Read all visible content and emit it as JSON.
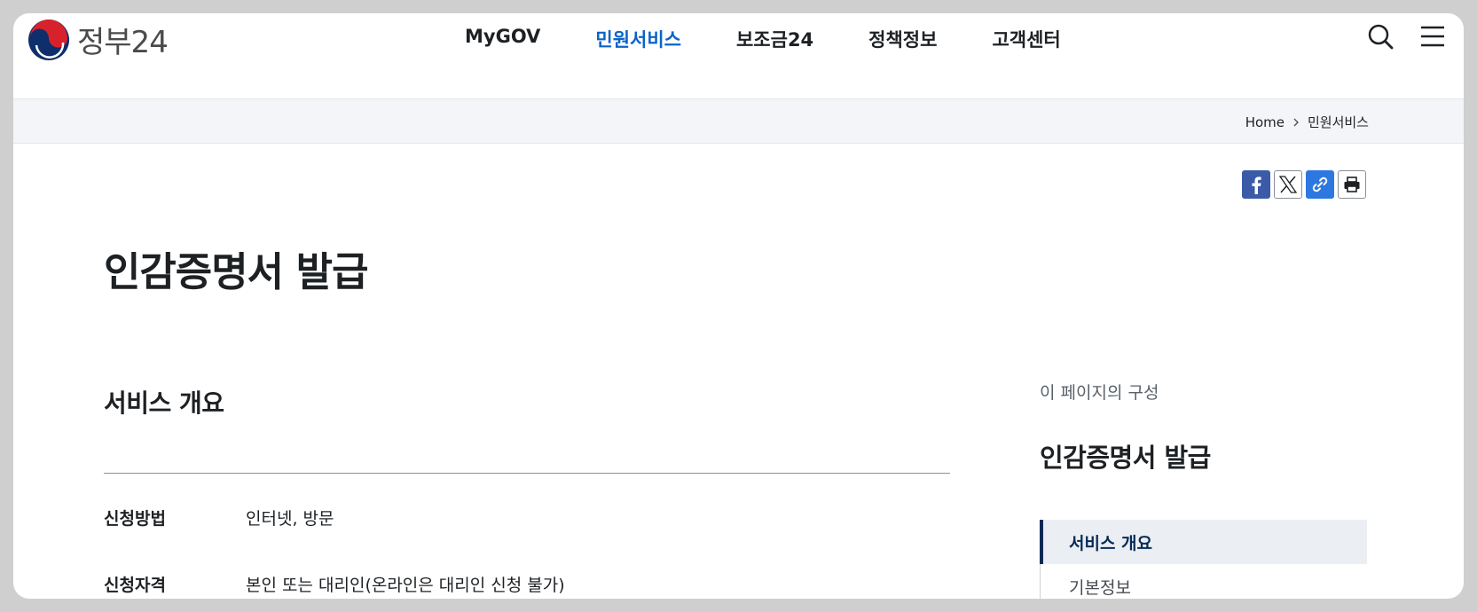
{
  "header": {
    "logo_text": "정부24",
    "nav": [
      {
        "label": "MyGOV",
        "active": false
      },
      {
        "label": "민원서비스",
        "active": true
      },
      {
        "label": "보조금24",
        "active": false
      },
      {
        "label": "정책정보",
        "active": false
      },
      {
        "label": "고객센터",
        "active": false
      }
    ],
    "icons": [
      "search-icon",
      "menu-icon"
    ]
  },
  "breadcrumb": {
    "items": [
      "Home",
      "민원서비스"
    ]
  },
  "share": {
    "buttons": [
      "facebook-icon",
      "x-icon",
      "link-icon",
      "print-icon"
    ]
  },
  "page": {
    "title": "인감증명서 발급"
  },
  "section": {
    "title": "서비스 개요",
    "rows": [
      {
        "label": "신청방법",
        "value": "인터넷, 방문"
      },
      {
        "label": "신청자격",
        "value": "본인 또는 대리인(온라인은 대리인 신청 불가)"
      }
    ]
  },
  "toc": {
    "caption": "이 페이지의 구성",
    "title": "인감증명서 발급",
    "items": [
      {
        "label": "서비스 개요",
        "active": true
      },
      {
        "label": "기본정보",
        "active": false
      }
    ]
  },
  "colors": {
    "accent": "#0b63c9",
    "toc_active": "#052b57",
    "facebook": "#3b5ba8",
    "link": "#2d78e0"
  }
}
